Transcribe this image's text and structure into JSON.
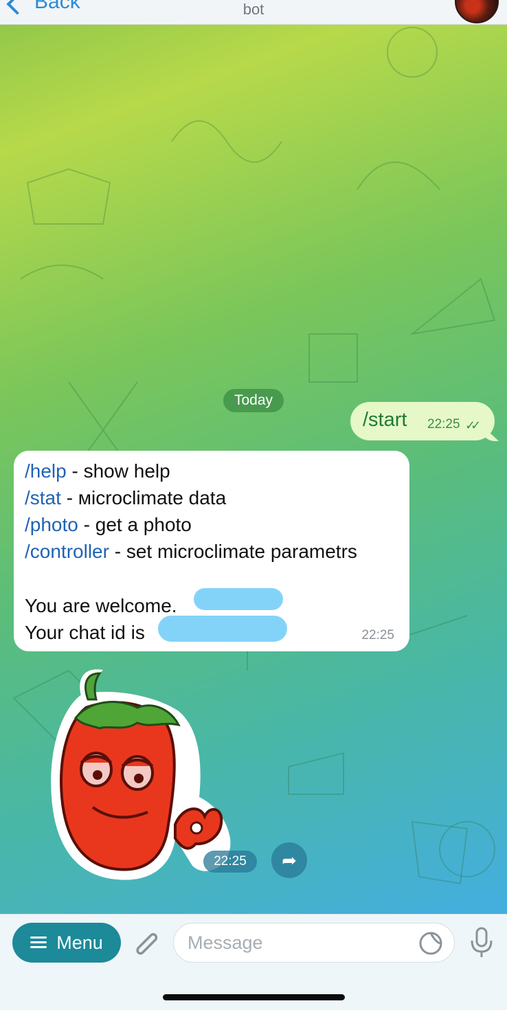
{
  "header": {
    "back_label": "Back",
    "title": "bot"
  },
  "chat": {
    "date_label": "Today",
    "outgoing": {
      "text": "/start",
      "time": "22:25",
      "status": "read-double-check"
    },
    "incoming": {
      "commands": [
        {
          "cmd": "/help",
          "desc": " - show help"
        },
        {
          "cmd": "/stat",
          "desc": " - мicroclimate data"
        },
        {
          "cmd": "/photo",
          "desc": " - get a photo"
        },
        {
          "cmd": "/controller",
          "desc": " - set microclimate parametrs"
        }
      ],
      "welcome": "You are welcome.",
      "chat_id_label": "Your chat id is",
      "time": "22:25"
    },
    "sticker": {
      "name": "red-pepper-sticker",
      "time": "22:25"
    }
  },
  "input_bar": {
    "menu_label": "Menu",
    "placeholder": "Message"
  },
  "colors": {
    "accent": "#1c8a99",
    "link": "#1f63b4",
    "outgoing_bubble": "#e6f8c8",
    "outgoing_text": "#1f7a35"
  }
}
